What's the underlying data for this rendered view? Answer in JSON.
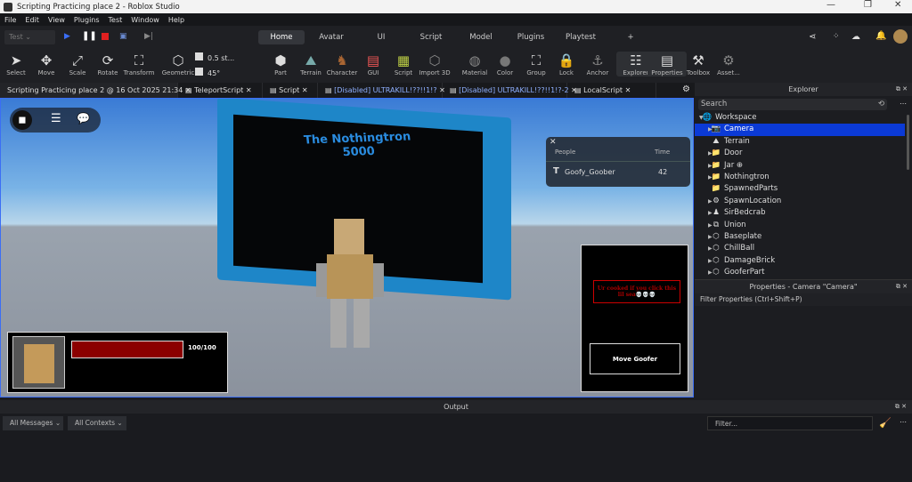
{
  "window": {
    "title": "Scripting Practicing place 2 - Roblox Studio",
    "minimize": "—",
    "maximize": "❐",
    "close": "✕"
  },
  "menu": [
    "File",
    "Edit",
    "View",
    "Plugins",
    "Test",
    "Window",
    "Help"
  ],
  "playbar": {
    "mode": "Test"
  },
  "ribbon_tabs": [
    "Home",
    "Avatar",
    "UI",
    "Script",
    "Model",
    "Plugins",
    "Playtest",
    "+"
  ],
  "active_tab": "Home",
  "tools": [
    "Select",
    "Move",
    "Scale",
    "Rotate",
    "Transform",
    "Geometric",
    "Part",
    "Terrain",
    "Character",
    "GUI",
    "Script",
    "Import 3D",
    "Material",
    "Color",
    "Group",
    "Lock",
    "Anchor",
    "Explorer",
    "Properties",
    "Toolbox",
    "Asset..."
  ],
  "snap": {
    "move": "0.5 st...",
    "rotate": "45°"
  },
  "doc_tabs": [
    "Scripting Practicing place 2 @ 16 Oct 2025 21:34",
    "TeleportScript",
    "Script",
    "[Disabled] ULTRAKILL!??!!1!?",
    "[Disabled] ULTRAKILL!??!!1!?-2",
    "LocalScript"
  ],
  "game": {
    "board_title": "The Nothingtron\n5000",
    "leaderboard": {
      "headers": [
        "People",
        "Time"
      ],
      "rows": [
        {
          "name": "Goofy_Goober",
          "time": "42"
        }
      ]
    },
    "health": {
      "text": "100/100",
      "fraction": 1.0,
      "color": "#8b0000"
    },
    "warning": "Ur cooked if you click this lil sea💀💀💀",
    "move_button": "Move Goofer"
  },
  "explorer": {
    "title": "Explorer",
    "search_placeholder": "Search",
    "items": [
      {
        "label": "Workspace",
        "icon": "🌐"
      },
      {
        "label": "Camera",
        "icon": "📷"
      },
      {
        "label": "Terrain",
        "icon": "⛰"
      },
      {
        "label": "Door",
        "icon": "📁"
      },
      {
        "label": "Jar ⊕",
        "icon": "📁"
      },
      {
        "label": "Nothingtron",
        "icon": "📁"
      },
      {
        "label": "SpawnedParts",
        "icon": "📁"
      },
      {
        "label": "SpawnLocation",
        "icon": "⚙"
      },
      {
        "label": "SirBedcrab",
        "icon": "♟"
      },
      {
        "label": "Union",
        "icon": "⧉"
      },
      {
        "label": "Baseplate",
        "icon": "⬡"
      },
      {
        "label": "ChillBall",
        "icon": "⬡"
      },
      {
        "label": "DamageBrick",
        "icon": "⬡"
      },
      {
        "label": "GooferPart",
        "icon": "⬡"
      }
    ]
  },
  "properties": {
    "title": "Properties - Camera \"Camera\"",
    "filter": "Filter Properties (Ctrl+Shift+P)"
  },
  "output": {
    "title": "Output",
    "messages": "All Messages",
    "contexts": "All Contexts",
    "filter_placeholder": "Filter..."
  }
}
